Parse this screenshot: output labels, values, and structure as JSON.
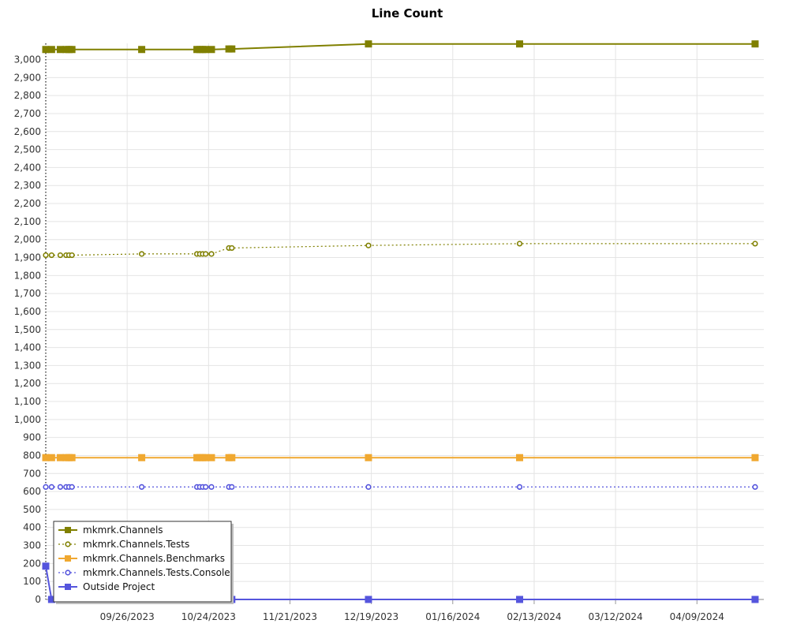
{
  "chart_data": {
    "type": "line",
    "title": "Line Count",
    "xlabel": "",
    "ylabel": "",
    "x_axis_type": "date",
    "xlim": [
      "2023-08-29",
      "2024-05-02"
    ],
    "ylim": [
      0,
      3090
    ],
    "y_ticks": [
      0,
      100,
      200,
      300,
      400,
      500,
      600,
      700,
      800,
      900,
      1000,
      1100,
      1200,
      1300,
      1400,
      1500,
      1600,
      1700,
      1800,
      1900,
      2000,
      2100,
      2200,
      2300,
      2400,
      2500,
      2600,
      2700,
      2800,
      2900,
      3000
    ],
    "y_tick_labels": [
      "0",
      "100",
      "200",
      "300",
      "400",
      "500",
      "600",
      "700",
      "800",
      "900",
      "1,000",
      "1,100",
      "1,200",
      "1,300",
      "1,400",
      "1,500",
      "1,600",
      "1,700",
      "1,800",
      "1,900",
      "2,000",
      "2,100",
      "2,200",
      "2,300",
      "2,400",
      "2,500",
      "2,600",
      "2,700",
      "2,800",
      "2,900",
      "3,000"
    ],
    "x_ticks": [
      "2023-09-26",
      "2023-10-24",
      "2023-11-21",
      "2023-12-19",
      "2024-01-16",
      "2024-02-13",
      "2024-03-12",
      "2024-04-09"
    ],
    "x_tick_labels": [
      "09/26/2023",
      "10/24/2023",
      "11/21/2023",
      "12/19/2023",
      "01/16/2024",
      "02/13/2024",
      "03/12/2024",
      "04/09/2024"
    ],
    "grid": true,
    "legend_position": "bottom-left",
    "x": [
      "2023-08-29",
      "2023-08-31",
      "2023-09-03",
      "2023-09-05",
      "2023-09-06",
      "2023-09-07",
      "2023-10-01",
      "2023-10-20",
      "2023-10-21",
      "2023-10-22",
      "2023-10-23",
      "2023-10-25",
      "2023-10-31",
      "2023-11-01",
      "2023-12-18",
      "2024-02-08",
      "2024-04-29"
    ],
    "series": [
      {
        "name": "mkmrk.Channels",
        "color": "#808000",
        "line_style": "solid",
        "marker": "square",
        "values": [
          3056,
          3056,
          3056,
          3056,
          3056,
          3056,
          3056,
          3056,
          3056,
          3056,
          3056,
          3056,
          3059,
          3059,
          3087,
          3087,
          3087
        ]
      },
      {
        "name": "mkmrk.Channels.Tests",
        "color": "#808000",
        "line_style": "dotted",
        "marker": "circle",
        "values": [
          1913,
          1913,
          1913,
          1913,
          1913,
          1913,
          1920,
          1920,
          1920,
          1920,
          1920,
          1920,
          1953,
          1953,
          1967,
          1977,
          1977
        ]
      },
      {
        "name": "mkmrk.Channels.Benchmarks",
        "color": "#f0a830",
        "line_style": "solid",
        "marker": "square",
        "values": [
          788,
          788,
          788,
          788,
          788,
          788,
          788,
          788,
          788,
          788,
          788,
          788,
          788,
          788,
          788,
          788,
          788
        ]
      },
      {
        "name": "mkmrk.Channels.Tests.Console",
        "color": "#5555dd",
        "line_style": "dotted",
        "marker": "circle",
        "values": [
          625,
          625,
          625,
          625,
          625,
          625,
          625,
          625,
          625,
          625,
          625,
          625,
          625,
          625,
          625,
          625,
          625
        ]
      },
      {
        "name": "Outside Project",
        "color": "#5555dd",
        "line_style": "solid",
        "marker": "square",
        "values": [
          185,
          0,
          0,
          0,
          0,
          0,
          0,
          0,
          0,
          0,
          0,
          0,
          0,
          0,
          0,
          0,
          0
        ]
      }
    ]
  }
}
